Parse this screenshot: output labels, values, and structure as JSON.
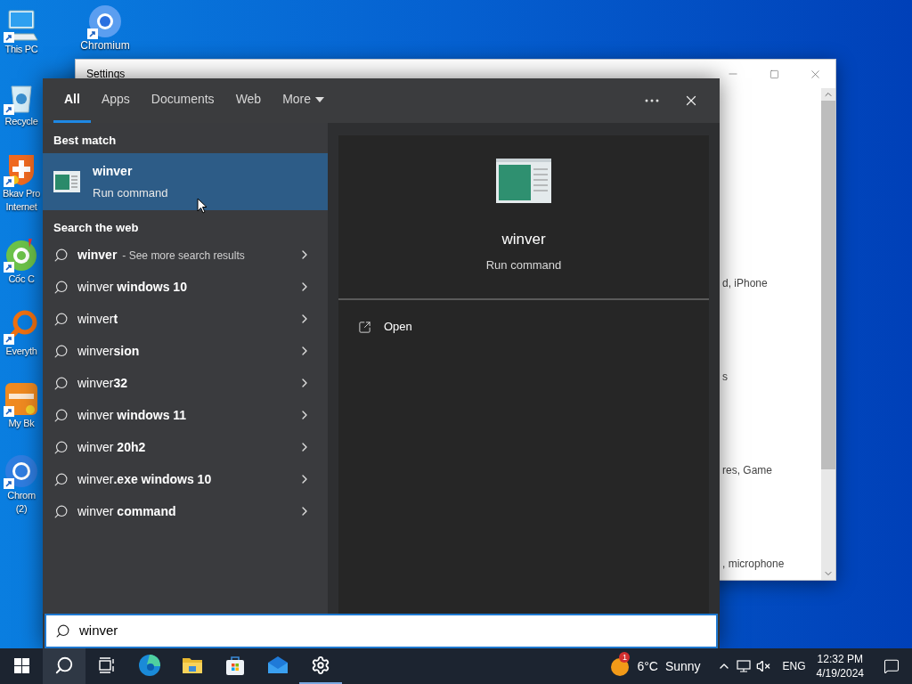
{
  "desktop_icons": [
    {
      "kind": "pc",
      "lines": [
        "This PC"
      ]
    },
    {
      "kind": "recycle",
      "lines": [
        "Recycle"
      ]
    },
    {
      "kind": "bkav",
      "lines": [
        "Bkav Pro",
        "Internet"
      ]
    },
    {
      "kind": "coccoc",
      "lines": [
        "Cốc C"
      ]
    },
    {
      "kind": "everything",
      "lines": [
        "Everyth"
      ]
    },
    {
      "kind": "mybkav",
      "lines": [
        "My Bk"
      ]
    },
    {
      "kind": "chrome",
      "lines": [
        "Chrom",
        "(2)"
      ]
    }
  ],
  "desktop_icon_top": {
    "kind": "chromium",
    "lines": [
      "Chromium"
    ]
  },
  "settings_window": {
    "title": "Settings",
    "snippets": [
      "d, iPhone",
      "s",
      "res, Game",
      ", microphone"
    ]
  },
  "search": {
    "tabs": [
      {
        "label": "All",
        "selected": true
      },
      {
        "label": "Apps",
        "selected": false
      },
      {
        "label": "Documents",
        "selected": false
      },
      {
        "label": "Web",
        "selected": false
      },
      {
        "label": "More",
        "selected": false,
        "dropdown": true
      }
    ],
    "best_match": {
      "heading": "Best match",
      "title": "winver",
      "subtitle": "Run command",
      "selected": true
    },
    "web": {
      "heading": "Search the web",
      "items": [
        {
          "text": "**winver**",
          "note": "- See more search results"
        },
        {
          "text": "winver **windows 10**"
        },
        {
          "text": "winver**t**"
        },
        {
          "text": "winver**sion**"
        },
        {
          "text": "winver**32**"
        },
        {
          "text": "winver **windows 11**"
        },
        {
          "text": "winver **20h2**"
        },
        {
          "text": "winver**.exe windows 10**"
        },
        {
          "text": "winver **command**"
        }
      ]
    },
    "preview": {
      "title": "winver",
      "subtitle": "Run command",
      "actions": [
        "Open"
      ]
    },
    "query": "winver"
  },
  "taskbar": {
    "apps": [
      {
        "kind": "start",
        "selected": false,
        "active": false
      },
      {
        "kind": "search",
        "selected": true,
        "active": false
      },
      {
        "kind": "taskview",
        "selected": false,
        "active": false
      },
      {
        "kind": "edge",
        "selected": false,
        "active": false
      },
      {
        "kind": "explorer",
        "selected": false,
        "active": false
      },
      {
        "kind": "store",
        "selected": false,
        "active": false
      },
      {
        "kind": "mail",
        "selected": false,
        "active": false
      },
      {
        "kind": "settings",
        "selected": false,
        "active": true
      }
    ],
    "weather": {
      "badge": "1",
      "temperature": "6°C",
      "condition": "Sunny"
    },
    "language": "ENG",
    "time": "12:32 PM",
    "date": "4/19/2024"
  }
}
